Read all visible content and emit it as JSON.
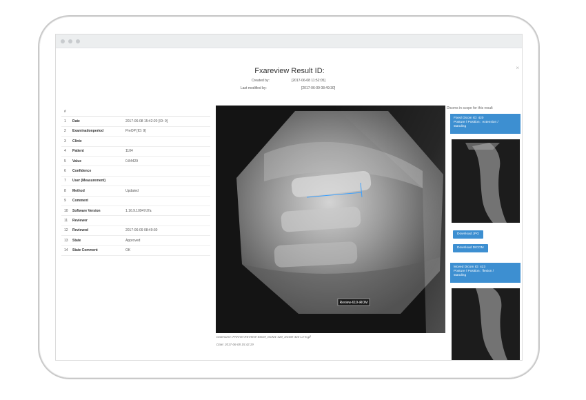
{
  "modal": {
    "title": "Fxareview Result ID:",
    "created_by_label": "Created by:",
    "created_at": "[2017-06-08 11:52:05]",
    "last_modified_label": "Last modified by:",
    "modified_at": "[2017-06-09 08:49:30]",
    "close_icon": "×"
  },
  "table": {
    "header_hash": "#",
    "rows": [
      {
        "n": "1",
        "label": "Date",
        "value": "2017-06-08 15:42:20 [ID: 9]"
      },
      {
        "n": "2",
        "label": "Examinationperiod",
        "value": "PreOP [ID: 9]"
      },
      {
        "n": "3",
        "label": "Clinic",
        "value": ""
      },
      {
        "n": "4",
        "label": "Patient",
        "value": "1104"
      },
      {
        "n": "5",
        "label": "Value",
        "value": "0.84429"
      },
      {
        "n": "6",
        "label": "Confidence",
        "value": ""
      },
      {
        "n": "7",
        "label": "User (Measurement)",
        "value": ""
      },
      {
        "n": "8",
        "label": "Method",
        "value": "Updated"
      },
      {
        "n": "9",
        "label": "Comment",
        "value": ""
      },
      {
        "n": "10",
        "label": "Software Version",
        "value": "1.16.9.10947d7a"
      },
      {
        "n": "11",
        "label": "Reviewer",
        "value": ""
      },
      {
        "n": "12",
        "label": "Reviewed",
        "value": "2017-06-09 08:49:30"
      },
      {
        "n": "13",
        "label": "State",
        "value": "Approved"
      },
      {
        "n": "14",
        "label": "State Comment",
        "value": "OK"
      }
    ]
  },
  "viewer": {
    "image_label": "Review-619-iROM",
    "filename_caption": "Datename: PARAM-REVIEW-ID619_DCM1-420_DCM2-423-L4-5.gif",
    "date_caption": "Date: 2017-06-08 15:42:19"
  },
  "sidebar": {
    "title": "Dicoms in scope for this result",
    "fixed_card": {
      "line1": "Fixed Dicom ID: 420",
      "line2": "Posture / Position : extension /",
      "line3": "standing"
    },
    "download_jpg": "Download JPG",
    "download_dicom": "Download DICOM",
    "moved_card": {
      "line1": "Moved Dicom ID: 423",
      "line2": "Posture / Position : flexion /",
      "line3": "standing"
    }
  },
  "colors": {
    "accent": "#3d8fd1",
    "measure_line": "#3aa0ff"
  }
}
